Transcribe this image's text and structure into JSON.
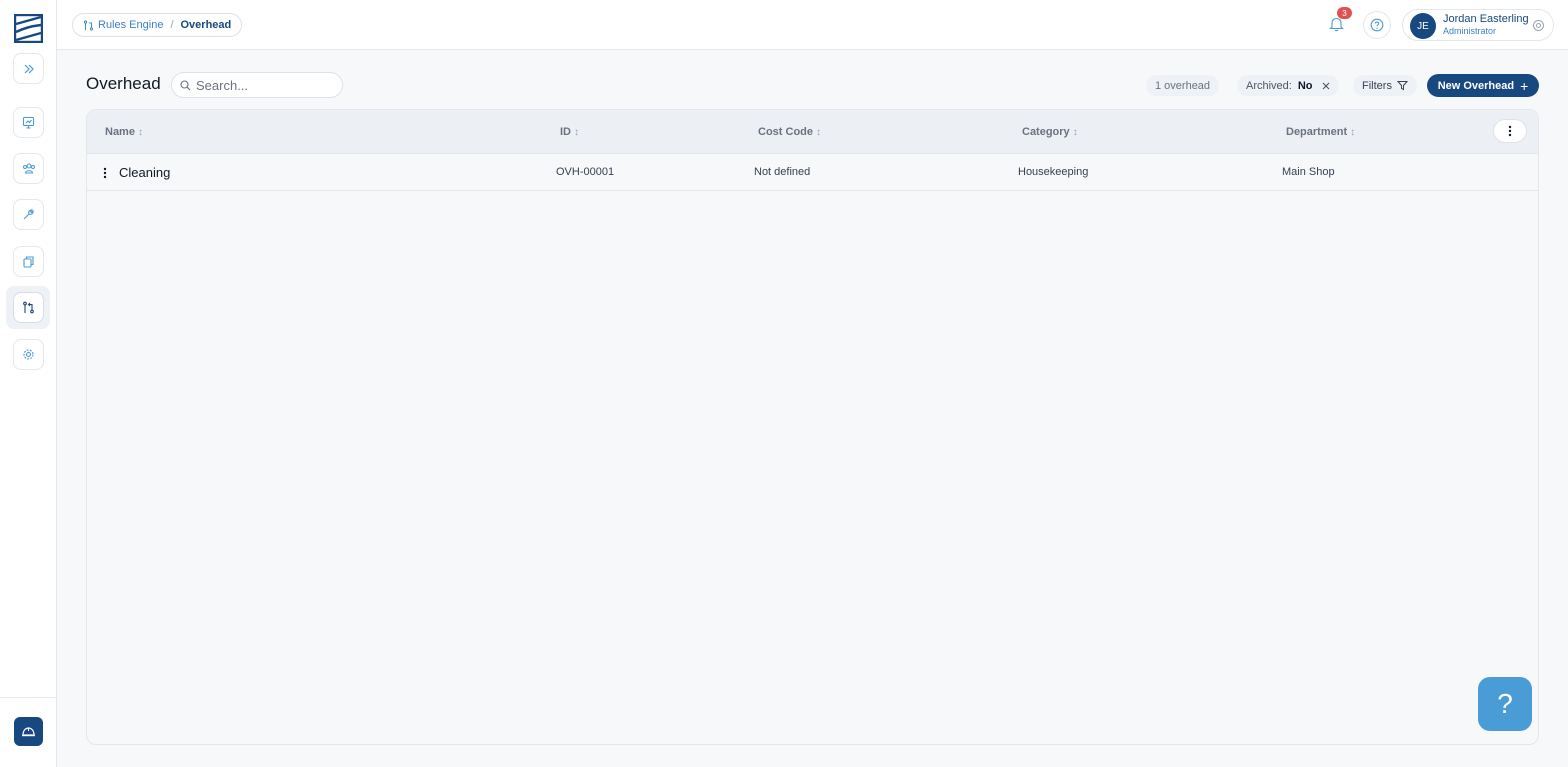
{
  "app": {
    "brand_color": "#17487f",
    "accent_color": "#3b82c4"
  },
  "sidebar": {
    "items": [
      {
        "icon": "double-chevron-right-icon"
      },
      {
        "icon": "clipboard-chart-icon"
      },
      {
        "icon": "users-icon"
      },
      {
        "icon": "wrench-icon"
      },
      {
        "icon": "copy-icon"
      },
      {
        "icon": "route-icon",
        "active": true
      },
      {
        "icon": "gear-icon"
      }
    ],
    "bottom_icon": "hard-hat-icon"
  },
  "breadcrumb": {
    "parent": "Rules Engine",
    "separator": "/",
    "current": "Overhead"
  },
  "header": {
    "notification_count": "3",
    "user": {
      "initials": "JE",
      "name": "Jordan Easterling",
      "role": "Administrator"
    }
  },
  "page": {
    "title": "Overhead",
    "search_placeholder": "Search...",
    "count_label": "1 overhead",
    "archived_label": "Archived:",
    "archived_value": "No",
    "filters_label": "Filters",
    "new_button_label": "New Overhead"
  },
  "table": {
    "columns": [
      {
        "label": "Name"
      },
      {
        "label": "ID"
      },
      {
        "label": "Cost Code"
      },
      {
        "label": "Category"
      },
      {
        "label": "Department"
      }
    ],
    "rows": [
      {
        "name": "Cleaning",
        "id": "OVH-00001",
        "cost_code": "Not defined",
        "category": "Housekeeping",
        "department": "Main Shop"
      }
    ]
  },
  "help_fab": {
    "label": "?"
  }
}
